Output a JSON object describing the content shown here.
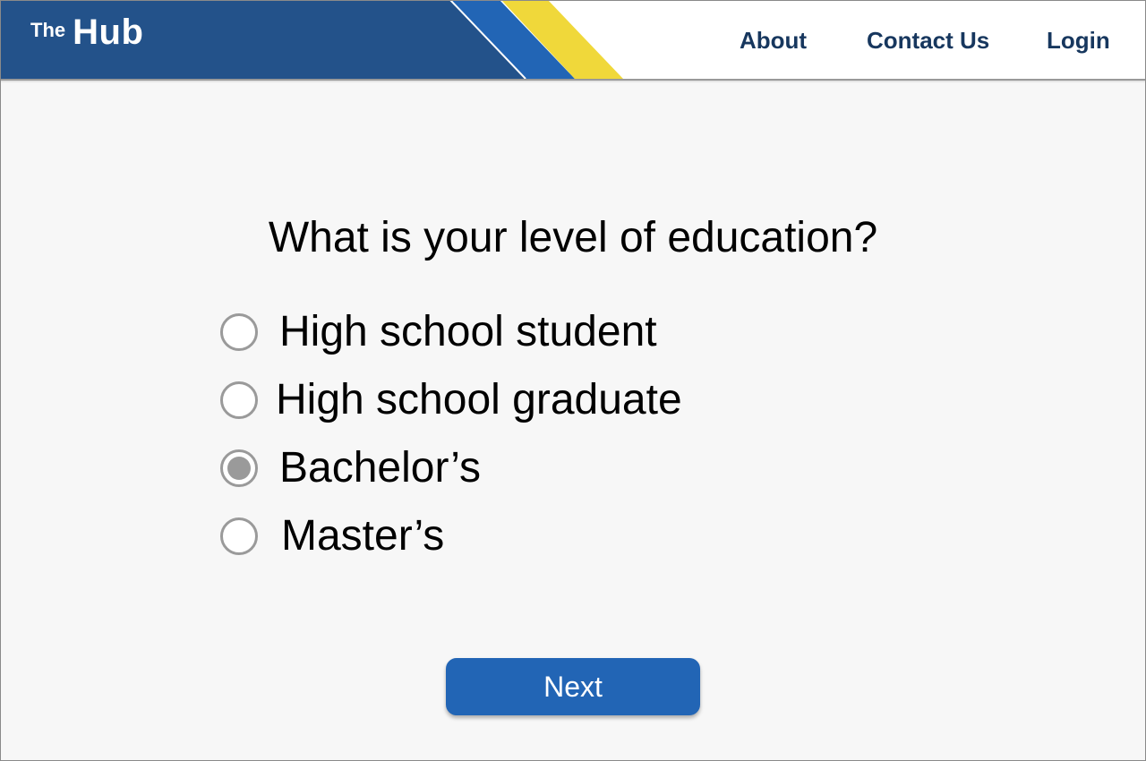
{
  "header": {
    "logo_small": "The",
    "logo_main": "Hub",
    "nav": {
      "about": "About",
      "contact": "Contact Us",
      "login": "Login"
    },
    "colors": {
      "dark_blue": "#23528a",
      "mid_blue": "#2265b5",
      "yellow": "#f0d83a",
      "nav_text": "#17375e"
    }
  },
  "question": {
    "title": "What is your level of education?",
    "options": [
      {
        "label": "High school student",
        "selected": false
      },
      {
        "label": "High school graduate",
        "selected": false
      },
      {
        "label": "Bachelor’s",
        "selected": true
      },
      {
        "label": "Master’s",
        "selected": false
      }
    ]
  },
  "actions": {
    "next_label": "Next"
  }
}
